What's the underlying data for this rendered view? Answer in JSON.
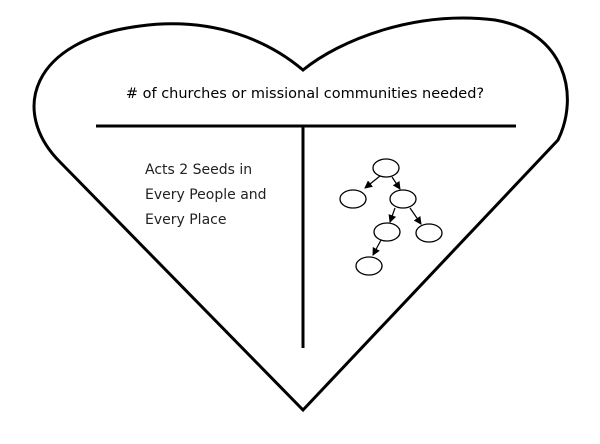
{
  "heading": "# of churches or missional communities needed?",
  "body_lines": [
    "Acts 2 Seeds in",
    "Every People and",
    "Every Place"
  ],
  "colors": {
    "stroke": "#000000",
    "background": "#ffffff",
    "text": "#222222"
  },
  "tree": {
    "nodes": [
      "root",
      "a",
      "b",
      "c",
      "d",
      "e"
    ],
    "edges": [
      [
        "root",
        "a"
      ],
      [
        "root",
        "b"
      ],
      [
        "b",
        "c"
      ],
      [
        "b",
        "d"
      ],
      [
        "c",
        "e"
      ]
    ]
  }
}
